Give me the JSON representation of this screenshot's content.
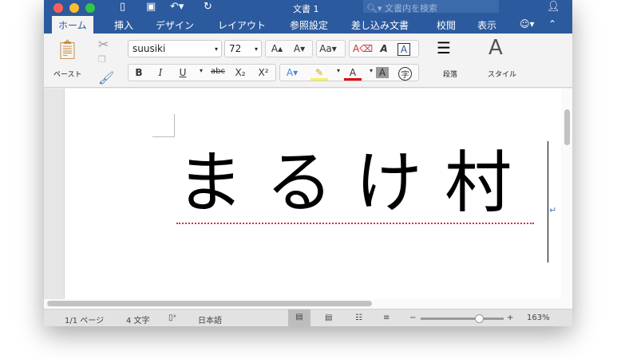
{
  "titlebar": {
    "title": "文書 1",
    "search_placeholder": "文書内を検索",
    "traffic": [
      "#fc5f57",
      "#fdbc2e",
      "#33c748"
    ]
  },
  "tabs": [
    "ホーム",
    "挿入",
    "デザイン",
    "レイアウト",
    "参照設定",
    "差し込み文書",
    "校閲",
    "表示"
  ],
  "ribbon": {
    "paste": "ペースト",
    "font_name": "suusiki",
    "font_size": "72",
    "bold": "B",
    "italic": "I",
    "underline": "U",
    "strike": "abc",
    "sub": "X₂",
    "sup": "X²",
    "paragraph": "段落",
    "styles": "スタイル",
    "grow": "A▴",
    "shrink": "A▾",
    "char_border": "A",
    "char_shading": "A",
    "enclosed": "字"
  },
  "document": {
    "text": "まるけ村",
    "return_mark": "↵"
  },
  "status": {
    "page": "1/1 ページ",
    "words": "4 文字",
    "language": "日本語",
    "zoom": "163%",
    "zoom_level": 0.7
  },
  "colors": {
    "accent": "#2c5a9e",
    "font_color": "#e00000",
    "highlight": "#f7f060"
  }
}
